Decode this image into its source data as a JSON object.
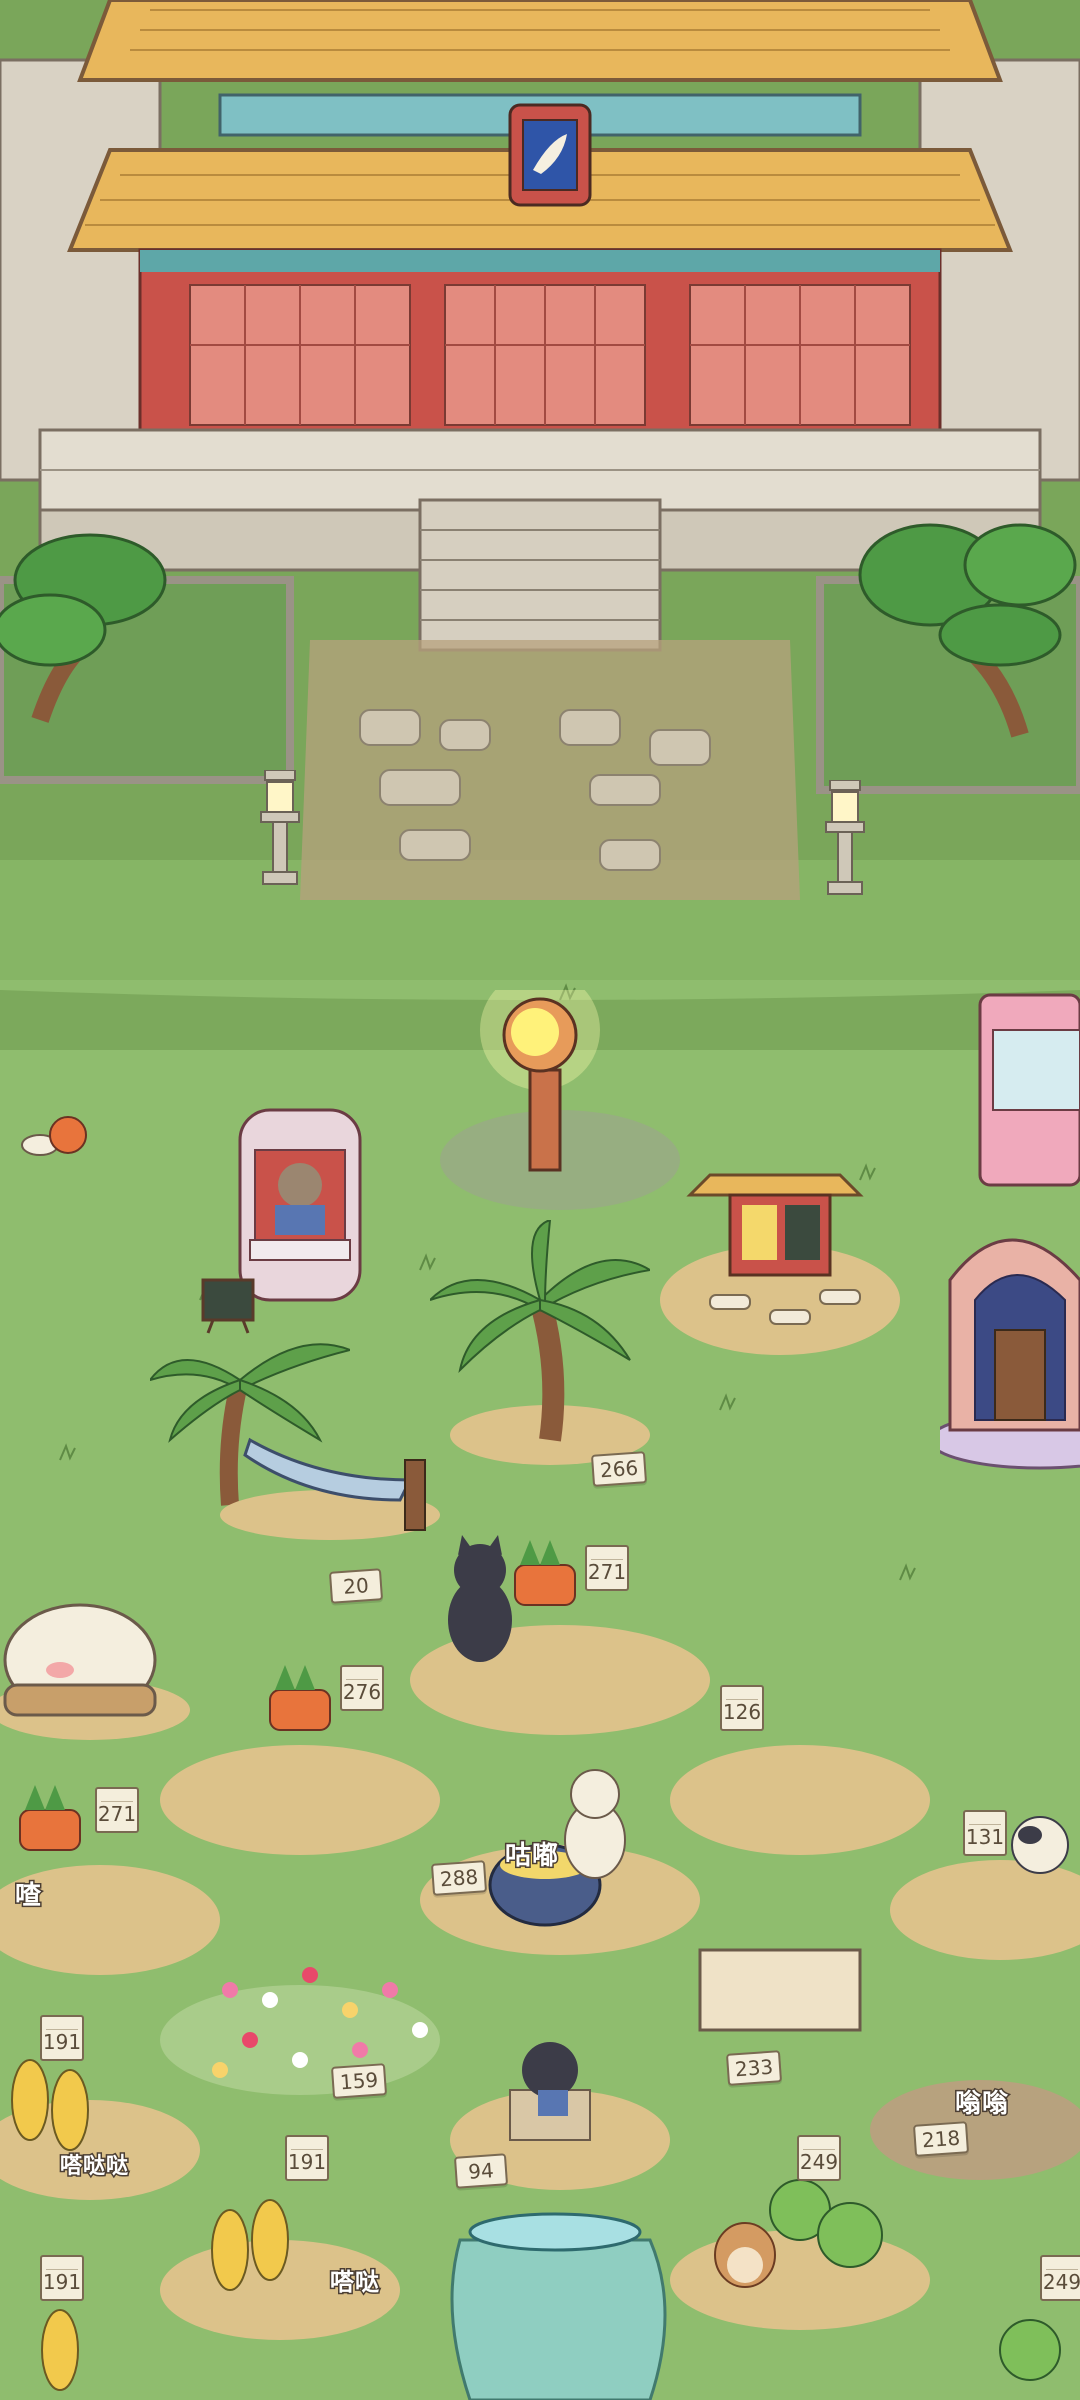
{
  "scene": {
    "temple_emblem_icon": "fish-emblem",
    "colors": {
      "grass": "#8fbd6e",
      "grass_dark": "#6f9e57",
      "roof": "#e8b75c",
      "pillar": "#c9524a",
      "stone": "#dcd6c8"
    }
  },
  "plots": {
    "p266": "266",
    "p20": "20",
    "p271a": "271",
    "p276": "276",
    "p126": "126",
    "p271b": "271",
    "p288": "288",
    "p131": "131",
    "p159": "159",
    "p233": "233",
    "p191a": "191",
    "p191b": "191",
    "p94": "94",
    "p249a": "249",
    "p218": "218",
    "p191c": "191",
    "p249b": "249"
  },
  "sfx": {
    "cooking": "咕嘟",
    "tiny_left": "喳",
    "mid_left": "嗒哒哒",
    "bottom_left": "嗒哒",
    "bottom_right": "嗡嗡"
  }
}
